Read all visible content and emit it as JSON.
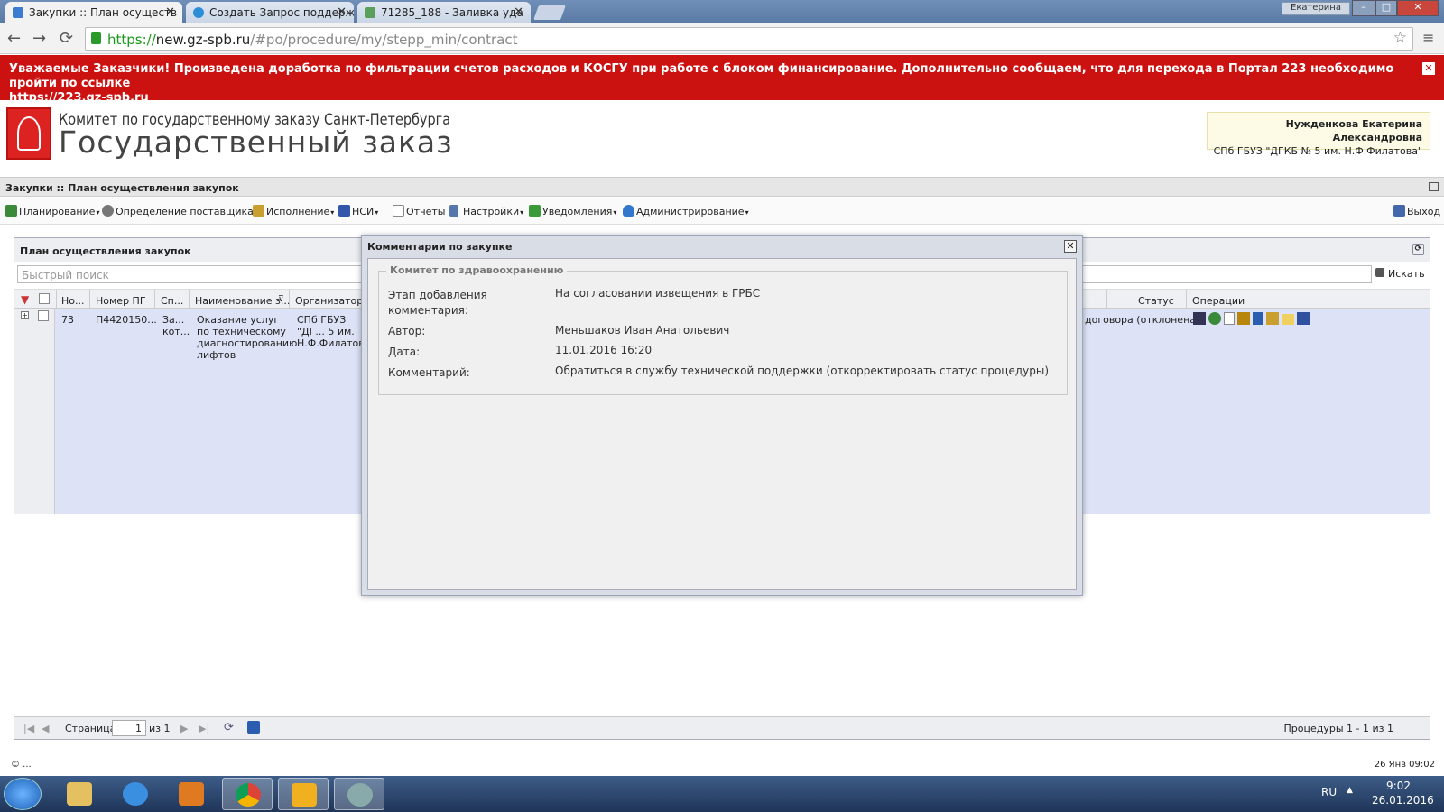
{
  "browser": {
    "tabs": [
      {
        "label": "Закупки :: План осуществ",
        "close": "✕",
        "icon_color": "#3b7bd0"
      },
      {
        "label": "Создать Запрос поддерж",
        "close": "✕",
        "icon_color": "#2d8ed8"
      },
      {
        "label": "71285_188 - Заливка уда",
        "close": "✕",
        "icon_color": "#5aa05a"
      }
    ],
    "window_user": "Екатерина",
    "url": {
      "scheme": "https://",
      "host": "new.gz-spb.ru",
      "path": "/#po/procedure/my/stepp_min/contract"
    }
  },
  "banner": {
    "text": "Уважаемые Заказчики! Произведена доработка по фильтрации счетов расходов и КОСГУ при работе с блоком финансирование. Дополнительно сообщаем, что для перехода в Портал 223 необходимо пройти по ссылке",
    "link": "https://223.gz-spb.ru",
    "close": "✕",
    "color": "#cc1111"
  },
  "header": {
    "org_line1": "Комитет по государственному заказу Санкт-Петербурга",
    "org_line2": "Государственный заказ",
    "user_name": "Нужденкова Екатерина Александровна",
    "user_org": "СПб ГБУЗ \"ДГКБ № 5 им. Н.Ф.Филатова\""
  },
  "app_title": "Закупки :: План осуществления закупок",
  "menu": {
    "items": [
      {
        "label": "Планирование",
        "icon": "list-icon",
        "color": "#3a8a3a"
      },
      {
        "label": "Определение поставщика",
        "icon": "gear-icon",
        "color": "#666666"
      },
      {
        "label": "Исполнение",
        "icon": "folder-icon",
        "color": "#c9a030"
      },
      {
        "label": "НСИ",
        "icon": "book-icon",
        "color": "#3355aa"
      },
      {
        "label": "Отчеты",
        "icon": "report-icon",
        "color": "#888888"
      },
      {
        "label": "Настройки",
        "icon": "wrench-icon",
        "color": "#5577aa"
      },
      {
        "label": "Уведомления",
        "icon": "notification-icon",
        "color": "#3a9a3a"
      },
      {
        "label": "Администрирование",
        "icon": "admin-icon",
        "color": "#3377cc"
      }
    ],
    "logout": "Выход"
  },
  "panel": {
    "title": "План осуществления закупок",
    "search_placeholder": "Быстрый поиск",
    "search_button": "Искать",
    "columns": [
      "Но...",
      "Номер ПГ",
      "Сп...",
      "Наименование з...",
      "Организатор",
      "Статус",
      "Операции"
    ],
    "row": {
      "number": "73",
      "pg_number": "П4420150...",
      "method": "За... кот...",
      "name": "Оказание услуг по техническому диагностированию лифтов",
      "organizer": "СПб ГБУЗ \"ДГ... 5 им. Н.Ф.Филатова",
      "status": "договора (отклонена)"
    },
    "pager": {
      "page_label": "Страница",
      "page_value": "1",
      "of_label": "из 1",
      "summary": "Процедуры 1 - 1 из 1"
    }
  },
  "footer": {
    "copyright": "© ...",
    "datetime": "26 Янв 09:02"
  },
  "dialog": {
    "title": "Комментарии по закупке",
    "close": "✕",
    "group": "Комитет по здравоохранению",
    "fields": [
      {
        "label": "Этап добавления комментария:",
        "value": "На согласовании извещения в ГРБС"
      },
      {
        "label": "Автор:",
        "value": "Меньшаков Иван Анатольевич"
      },
      {
        "label": "Дата:",
        "value": "11.01.2016 16:20"
      },
      {
        "label": "Комментарий:",
        "value": "Обратиться в службу технической поддержки (откорректировать статус процедуры)"
      }
    ]
  },
  "taskbar": {
    "lang": "RU",
    "time": "9:02",
    "date": "26.01.2016"
  }
}
